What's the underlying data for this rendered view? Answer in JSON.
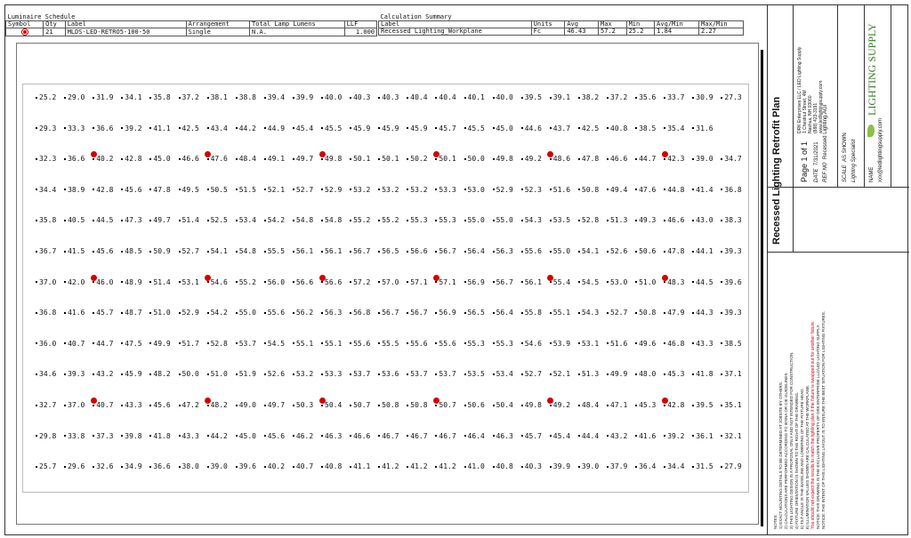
{
  "luminaire_schedule": {
    "title": "Luminaire Schedule",
    "headers": [
      "Symbol",
      "Qty",
      "Label",
      "Arrangement",
      "Total Lamp Lumens",
      "LLF"
    ],
    "row": {
      "qty": "21",
      "label": "MLDS-LED-RETRO5-100-50",
      "arrangement": "Single",
      "lumens": "N.A.",
      "llf": "1.000"
    }
  },
  "calculation_summary": {
    "title": "Calculation Summary",
    "headers": [
      "Label",
      "Units",
      "Avg",
      "Max",
      "Min",
      "Avg/Min",
      "Max/Min"
    ],
    "row": {
      "label": "Recessed Lighting_Workplane",
      "units": "Fc",
      "avg": "46.43",
      "max": "57.2",
      "min": "25.2",
      "avg_min": "1.84",
      "max_min": "2.27"
    }
  },
  "grid_values": [
    [
      "25.2",
      "29.0",
      "31.9",
      "34.1",
      "35.8",
      "37.2",
      "38.1",
      "38.8",
      "39.4",
      "39.9",
      "40.0",
      "40.3",
      "40.3",
      "40.4",
      "40.4",
      "40.1",
      "40.0",
      "39.5",
      "39.1",
      "38.2",
      "37.2",
      "35.6",
      "33.7",
      "30.9",
      "27.3"
    ],
    [
      "29.3",
      "33.3",
      "36.6",
      "39.2",
      "41.1",
      "42.5",
      "43.4",
      "44.2",
      "44.9",
      "45.4",
      "45.5",
      "45.9",
      "45.9",
      "45.9",
      "45.7",
      "45.5",
      "45.0",
      "44.6",
      "43.7",
      "42.5",
      "40.8",
      "38.5",
      "35.4",
      "31.6"
    ],
    [
      "32.3",
      "36.6",
      "40.2",
      "42.8",
      "45.0",
      "46.6",
      "47.6",
      "48.4",
      "49.1",
      "49.7",
      "49.8",
      "50.1",
      "50.1",
      "50.2",
      "50.1",
      "50.0",
      "49.8",
      "49.2",
      "48.6",
      "47.8",
      "46.6",
      "44.7",
      "42.3",
      "39.0",
      "34.7"
    ],
    [
      "34.4",
      "38.9",
      "42.8",
      "45.6",
      "47.8",
      "49.5",
      "50.5",
      "51.5",
      "52.1",
      "52.7",
      "52.9",
      "53.2",
      "53.2",
      "53.2",
      "53.3",
      "53.0",
      "52.9",
      "52.3",
      "51.6",
      "50.8",
      "49.4",
      "47.6",
      "44.8",
      "41.4",
      "36.8"
    ],
    [
      "35.8",
      "40.5",
      "44.5",
      "47.3",
      "49.7",
      "51.4",
      "52.5",
      "53.4",
      "54.2",
      "54.8",
      "54.8",
      "55.2",
      "55.2",
      "55.3",
      "55.3",
      "55.0",
      "55.0",
      "54.3",
      "53.5",
      "52.8",
      "51.3",
      "49.3",
      "46.6",
      "43.0",
      "38.3"
    ],
    [
      "36.7",
      "41.5",
      "45.6",
      "48.5",
      "50.9",
      "52.7",
      "54.1",
      "54.8",
      "55.5",
      "56.1",
      "56.1",
      "56.7",
      "56.5",
      "56.6",
      "56.7",
      "56.4",
      "56.3",
      "55.6",
      "55.0",
      "54.1",
      "52.6",
      "50.6",
      "47.8",
      "44.1",
      "39.3"
    ],
    [
      "37.0",
      "42.0",
      "46.0",
      "48.9",
      "51.4",
      "53.1",
      "54.6",
      "55.2",
      "56.0",
      "56.6",
      "56.6",
      "57.2",
      "57.0",
      "57.1",
      "57.1",
      "56.9",
      "56.7",
      "56.1",
      "55.4",
      "54.5",
      "53.0",
      "51.0",
      "48.3",
      "44.5",
      "39.6"
    ],
    [
      "36.8",
      "41.6",
      "45.7",
      "48.7",
      "51.0",
      "52.9",
      "54.2",
      "55.0",
      "55.6",
      "56.2",
      "56.3",
      "56.8",
      "56.7",
      "56.7",
      "56.9",
      "56.5",
      "56.4",
      "55.8",
      "55.1",
      "54.3",
      "52.7",
      "50.8",
      "47.9",
      "44.3",
      "39.3"
    ],
    [
      "36.0",
      "40.7",
      "44.7",
      "47.5",
      "49.9",
      "51.7",
      "52.8",
      "53.7",
      "54.5",
      "55.1",
      "55.1",
      "55.6",
      "55.5",
      "55.6",
      "55.6",
      "55.3",
      "55.3",
      "54.6",
      "53.9",
      "53.1",
      "51.6",
      "49.6",
      "46.8",
      "43.3",
      "38.5"
    ],
    [
      "34.6",
      "39.3",
      "43.2",
      "45.9",
      "48.2",
      "50.0",
      "51.0",
      "51.9",
      "52.6",
      "53.2",
      "53.3",
      "53.7",
      "53.6",
      "53.7",
      "53.7",
      "53.5",
      "53.4",
      "52.7",
      "52.1",
      "51.3",
      "49.9",
      "48.0",
      "45.3",
      "41.8",
      "37.1"
    ],
    [
      "32.7",
      "37.0",
      "40.7",
      "43.3",
      "45.6",
      "47.2",
      "48.2",
      "49.0",
      "49.7",
      "50.3",
      "50.4",
      "50.7",
      "50.8",
      "50.8",
      "50.7",
      "50.6",
      "50.4",
      "49.8",
      "49.2",
      "48.4",
      "47.1",
      "45.3",
      "42.8",
      "39.5",
      "35.1"
    ],
    [
      "29.8",
      "33.8",
      "37.3",
      "39.8",
      "41.8",
      "43.3",
      "44.2",
      "45.0",
      "45.6",
      "46.2",
      "46.3",
      "46.6",
      "46.7",
      "46.7",
      "46.7",
      "46.4",
      "46.3",
      "45.7",
      "45.4",
      "44.4",
      "43.2",
      "41.6",
      "39.2",
      "36.1",
      "32.1"
    ],
    [
      "25.7",
      "29.6",
      "32.6",
      "34.9",
      "36.6",
      "38.0",
      "39.0",
      "39.6",
      "40.2",
      "40.7",
      "40.8",
      "41.1",
      "41.2",
      "41.2",
      "41.2",
      "41.0",
      "40.8",
      "40.3",
      "39.9",
      "39.0",
      "37.9",
      "36.4",
      "34.4",
      "31.5",
      "27.9"
    ]
  ],
  "fixture_rows": [
    2,
    6,
    10
  ],
  "fixture_cols": [
    1.3,
    5.3,
    9.3,
    13.3,
    17.3,
    21.3
  ],
  "fixture_color": "#d40000",
  "title_block": {
    "plan_title": "Recessed Lighting Retrofit Plan",
    "page": "Page 1 of 1",
    "date_label": "DATE",
    "date": "7/31/2021",
    "ref_label": "REF NO",
    "ref": "Recessed Lighting.AGI",
    "scale_label": "SCALE",
    "scale": "AS SHOWN",
    "specialist": "Lighting Specialist",
    "name_label": "NAME",
    "email": "xxx@ledlightingsupply.com",
    "company_lines": [
      "DRK Enterprises LLC / LED Lighting Supply",
      "1 Chestnut Street, 4M",
      "Nashua, NH 03060",
      "(888) 423-3191",
      "www.ledlightingsupply.com"
    ],
    "logo_text": "LIGHTING SUPPLY",
    "notes_title": "NOTES:",
    "notes": [
      "1) EXACT MOUNTING DETAILS TO BE DETERMINED AT JOBSITE BY OTHERS.",
      "2) CALCULATIONS ARE PERFORMED ACCORDING TO IESNA OR CIE GUIDELINES.",
      "3) THIS LIGHTING DESIGN IS A PROPOSAL ONLY AND NOT INTENDED FOR CONSTRUCTION.",
      "4) FIXTURE ORIENTATION IS SHOWN TO THE RIGHT OF THE DRAWING.",
      "5) TILT ANGLE IS THE BASELINE AND LOWERING OF THE FIXTURE HEAD.",
      "6) ILLUMINATION VALUES SHOWN ARE CALCULATED AT THE WORKPLANE.",
      "You should not expect the results to match the lighting plan if the fixture is swapped out for another fixture.",
      "NOTICE: THIS DRAWING IS THE EXCLUSIVE PROPERTY OF DRK ENTERPRISE LLC/LED LIGHTING SUPPLY.",
      "NOTICE: THE INTENT OF THIS LIGHTING LAYOUT IS TO ENSURE THE BEST SITUATION FOR LIGHTING FIXTURES."
    ]
  }
}
